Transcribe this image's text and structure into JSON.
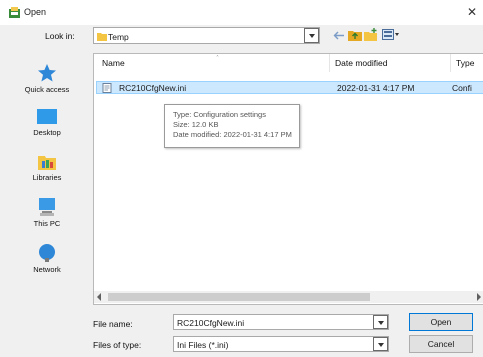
{
  "window": {
    "title": "Open",
    "close_glyph": "✕"
  },
  "toolbar": {
    "look_in_label": "Look in:",
    "look_in_value": "Temp",
    "icons": [
      "back-arrow-icon",
      "up-folder-icon",
      "new-folder-icon",
      "view-menu-icon"
    ]
  },
  "places": [
    {
      "label": "Quick access",
      "icon": "star-icon"
    },
    {
      "label": "Desktop",
      "icon": "desktop-icon"
    },
    {
      "label": "Libraries",
      "icon": "libraries-icon"
    },
    {
      "label": "This PC",
      "icon": "computer-icon"
    },
    {
      "label": "Network",
      "icon": "network-icon"
    }
  ],
  "file_list": {
    "columns": [
      "Name",
      "Date modified",
      "Type"
    ],
    "rows": [
      {
        "name": "RC210CfgNew.ini",
        "date": "2022-01-31 4:17 PM",
        "type": "Confi"
      }
    ]
  },
  "tooltip": {
    "lines": [
      "Type: Configuration settings",
      "Size: 12.0 KB",
      "Date modified: 2022-01-31 4:17 PM"
    ]
  },
  "form": {
    "file_name_label": "File name:",
    "file_name_value": "RC210CfgNew.ini",
    "file_type_label": "Files of type:",
    "file_type_value": "Ini Files (*.ini)"
  },
  "buttons": {
    "open": "Open",
    "cancel": "Cancel"
  },
  "colors": {
    "selection_bg": "#cce8ff",
    "selection_border": "#99d1ff",
    "accent": "#0078d7",
    "folder": "#f4c542"
  }
}
